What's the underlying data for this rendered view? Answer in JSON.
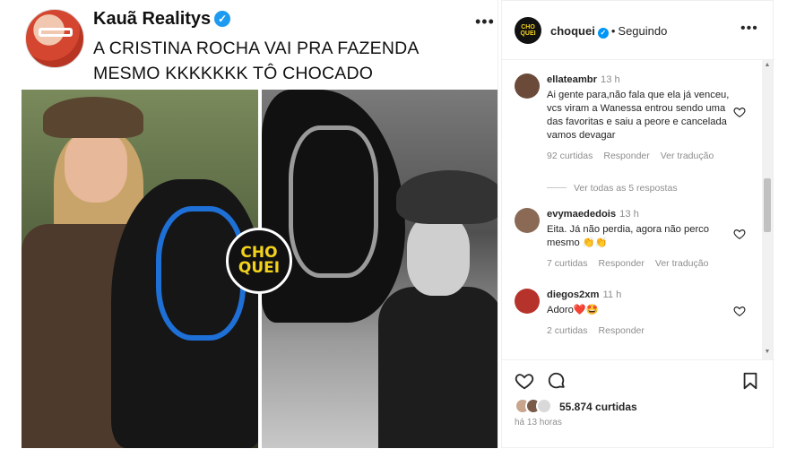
{
  "tweet": {
    "name": "Kauã Realitys",
    "text_line1": "A CRISTINA ROCHA VAI PRA FAZENDA",
    "text_line2": "MESMO KKKKKKK TÔ CHOCADO",
    "badge_line1": "CHO",
    "badge_line2": "QUEI"
  },
  "panel": {
    "username": "choquei",
    "follow_status": "Seguindo",
    "avatar_text": "CHO QUEI"
  },
  "comments": [
    {
      "user": "ellateambr",
      "time": "13 h",
      "text": "Ai gente para,não fala que ela já venceu, vcs viram a Wanessa entrou sendo uma das favoritas e saiu a peore e cancelada vamos devagar",
      "likes": "92 curtidas",
      "reply": "Responder",
      "translate": "Ver tradução",
      "avatar_color": "#6b4a3a"
    },
    {
      "user": "evymaededois",
      "time": "13 h",
      "text": "Eita. Já não perdia, agora não perco mesmo 👏👏",
      "likes": "7 curtidas",
      "reply": "Responder",
      "translate": "Ver tradução",
      "avatar_color": "#8a6a55"
    },
    {
      "user": "diegos2xm",
      "time": "11 h",
      "text": "Adoro❤️🤩",
      "likes": "2 curtidas",
      "reply": "Responder",
      "avatar_color": "#b5332a"
    }
  ],
  "view_replies": "Ver todas as 5 respostas",
  "likes_total": "55.874 curtidas",
  "posted_ago": "há 13 horas",
  "colors": {
    "accent_blue": "#0095f6",
    "badge_yellow": "#f3d21c",
    "muted": "#8e8e8e"
  }
}
